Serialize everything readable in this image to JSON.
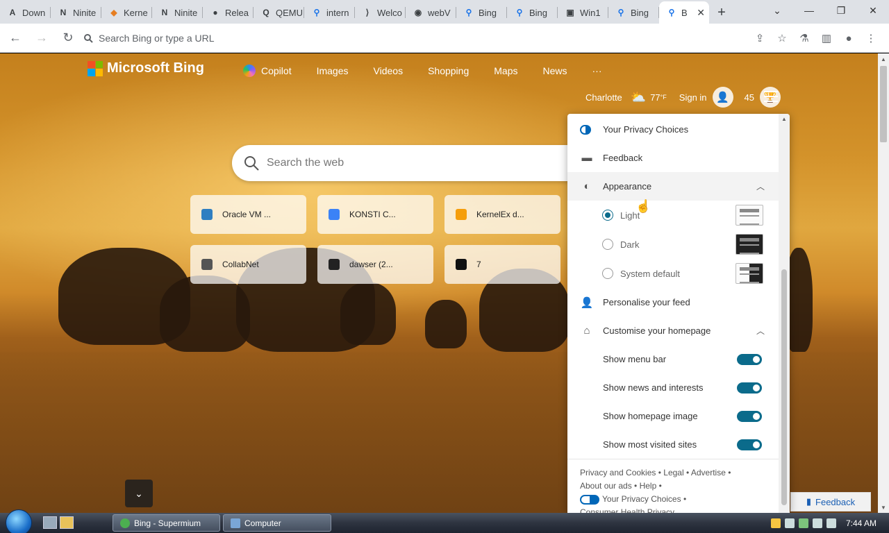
{
  "tabs": [
    {
      "label": "Down",
      "icon": "letter-a-icon",
      "glyph": "A"
    },
    {
      "label": "Ninite",
      "icon": "ninite-icon",
      "glyph": "N"
    },
    {
      "label": "Kerne",
      "icon": "diamond-icon",
      "glyph": "◆"
    },
    {
      "label": "Ninite",
      "icon": "ninite-icon",
      "glyph": "N"
    },
    {
      "label": "Relea",
      "icon": "github-icon",
      "glyph": "●"
    },
    {
      "label": "QEMU",
      "icon": "qemu-icon",
      "glyph": "Q"
    },
    {
      "label": "intern",
      "icon": "search-icon",
      "glyph": "⚲"
    },
    {
      "label": "Welco",
      "icon": "vscode-icon",
      "glyph": "⟩"
    },
    {
      "label": "webV",
      "icon": "globe-icon",
      "glyph": "◉"
    },
    {
      "label": "Bing",
      "icon": "search-icon",
      "glyph": "⚲"
    },
    {
      "label": "Bing",
      "icon": "search-icon",
      "glyph": "⚲"
    },
    {
      "label": "Win1",
      "icon": "window-icon",
      "glyph": "▣"
    },
    {
      "label": "Bing",
      "icon": "search-icon",
      "glyph": "⚲"
    },
    {
      "label": "B",
      "icon": "search-icon",
      "glyph": "⚲",
      "active": true
    }
  ],
  "omnibox": {
    "placeholder": "Search Bing or type a URL"
  },
  "bing": {
    "brand": "Microsoft Bing",
    "nav": [
      "Copilot",
      "Images",
      "Videos",
      "Shopping",
      "Maps",
      "News",
      "···"
    ],
    "location": "Charlotte",
    "temperature": "77",
    "temp_unit": "°F",
    "signin": "Sign in",
    "points": "45",
    "search_placeholder": "Search the web"
  },
  "tiles": [
    {
      "label": "Oracle VM ...",
      "icon": "virtualbox-icon",
      "color": "#2f7fc1"
    },
    {
      "label": "KONSTI C...",
      "icon": "globe-icon",
      "color": "#3b82f6"
    },
    {
      "label": "KernelEx d...",
      "icon": "diamond-icon",
      "color": "#f59e0b"
    },
    {
      "label": "CollabNet",
      "icon": "globe-icon",
      "color": "#555555"
    },
    {
      "label": "dawser (2...",
      "icon": "thumbnail-icon",
      "color": "#222222"
    },
    {
      "label": "7",
      "icon": "number-icon",
      "color": "#111111"
    }
  ],
  "panel": {
    "privacy": "Your Privacy Choices",
    "feedback": "Feedback",
    "appearance": "Appearance",
    "themes": [
      {
        "label": "Light",
        "checked": true
      },
      {
        "label": "Dark",
        "checked": false
      },
      {
        "label": "System default",
        "checked": false
      }
    ],
    "personalise": "Personalise your feed",
    "customise": "Customise your homepage",
    "toggles": [
      {
        "label": "Show menu bar",
        "on": true
      },
      {
        "label": "Show news and interests",
        "on": true
      },
      {
        "label": "Show homepage image",
        "on": true
      },
      {
        "label": "Show most visited sites",
        "on": true
      }
    ],
    "footer": {
      "privacy_cookies": "Privacy and Cookies",
      "legal": "Legal",
      "advertise": "Advertise",
      "about_ads": "About our ads",
      "help": "Help",
      "privacy_choices": "Your Privacy Choices",
      "health_privacy": "Consumer Health Privacy"
    }
  },
  "feedback_button": "Feedback",
  "taskbar": {
    "tasks": [
      "Bing - Supermium",
      "Computer"
    ],
    "clock": "7:44 AM"
  },
  "colors": {
    "accent": "#0b6b8b",
    "bing_blue": "#0067b8"
  }
}
